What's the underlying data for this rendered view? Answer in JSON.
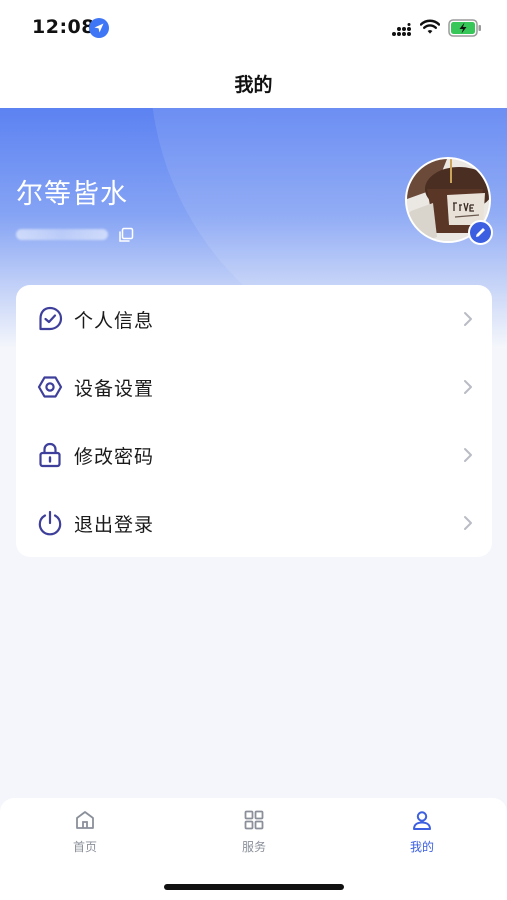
{
  "status_bar": {
    "time": "12:08",
    "icons": [
      "location-arrow-icon",
      "signal-icon",
      "wifi-icon",
      "battery-charging-icon"
    ]
  },
  "nav": {
    "title": "我的"
  },
  "profile": {
    "username": "尔等皆水",
    "phone_masked": "",
    "avatar_icon": "avatar-photo",
    "edit_icon": "pencil-icon"
  },
  "menu": {
    "items": [
      {
        "label": "个人信息",
        "icon": "personal-info-icon"
      },
      {
        "label": "设备设置",
        "icon": "device-settings-icon"
      },
      {
        "label": "修改密码",
        "icon": "lock-icon"
      },
      {
        "label": "退出登录",
        "icon": "power-icon"
      }
    ]
  },
  "tab_bar": {
    "tabs": [
      {
        "label": "首页",
        "icon": "home-icon",
        "active": false
      },
      {
        "label": "服务",
        "icon": "grid-icon",
        "active": false
      },
      {
        "label": "我的",
        "icon": "user-icon",
        "active": true
      }
    ]
  },
  "colors": {
    "accent": "#3b5fe0",
    "icon_stroke": "#3e3f9a",
    "hero_top": "#5c82f2",
    "background": "#f4f6fb"
  }
}
